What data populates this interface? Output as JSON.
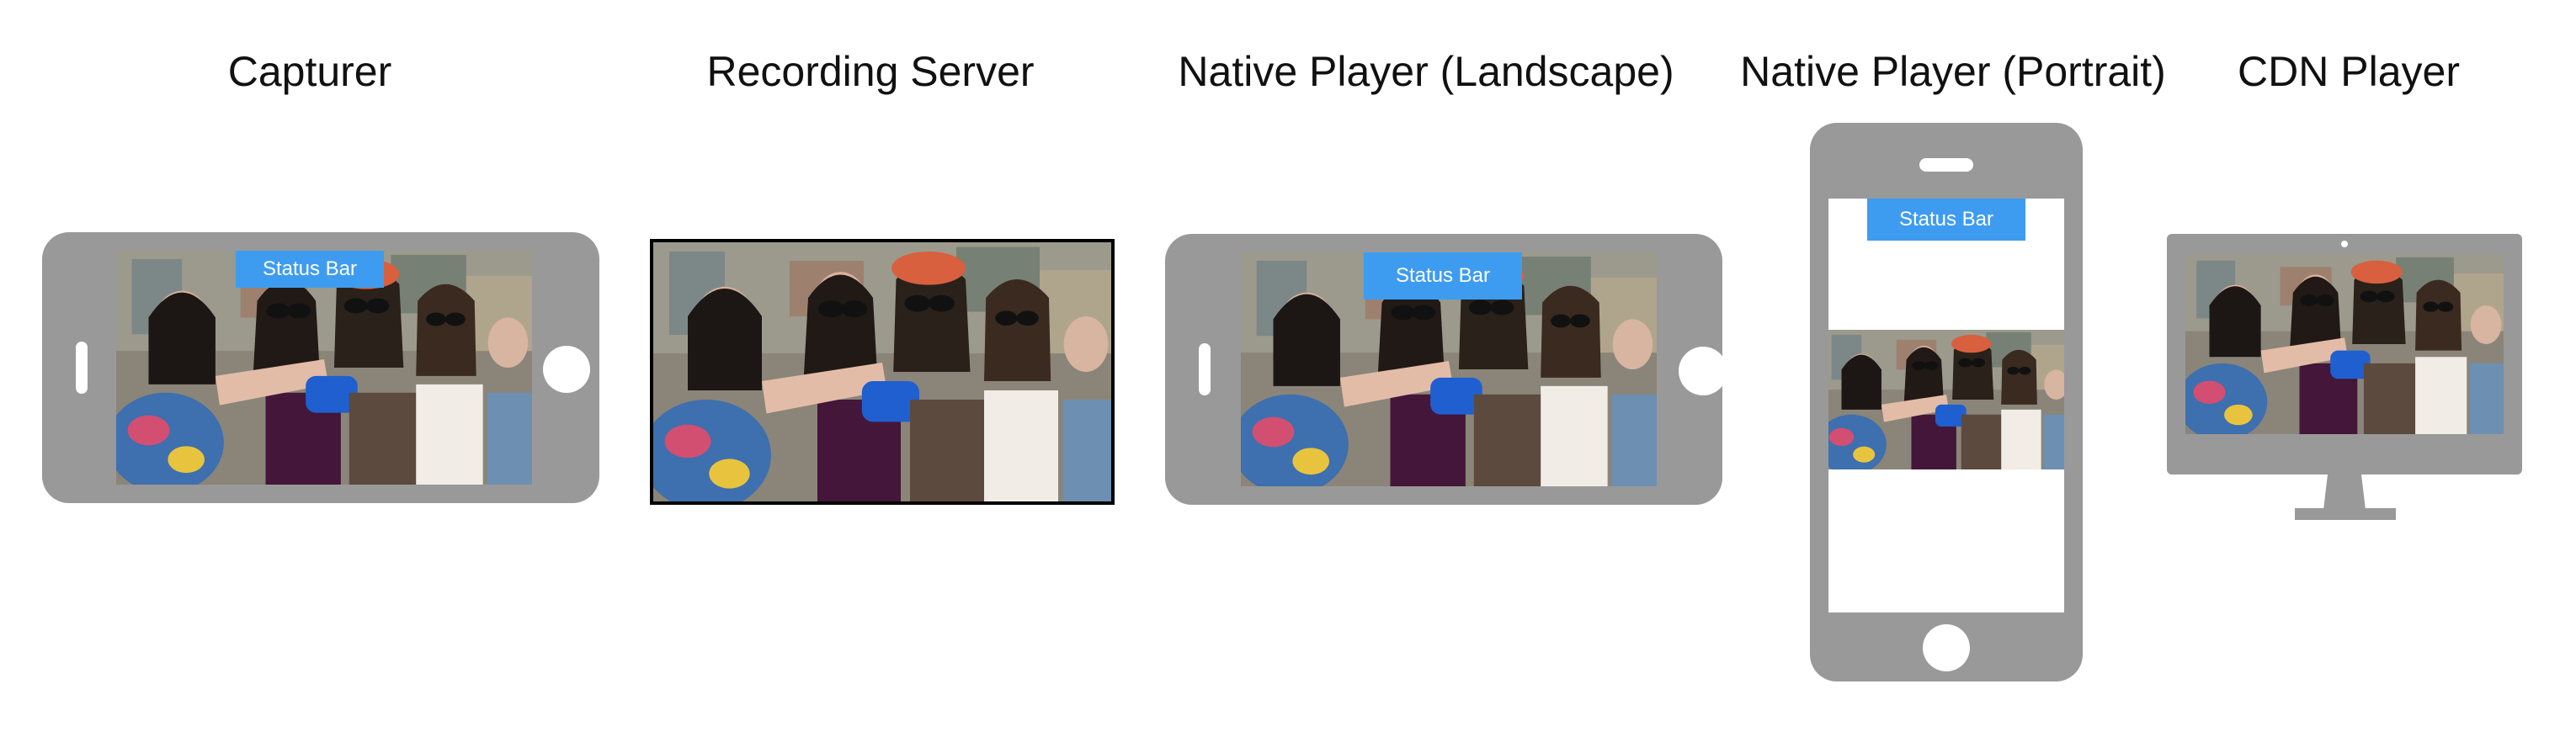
{
  "colors": {
    "device_grey": "#999999",
    "status_blue": "#3e9cf0",
    "frame_black": "#000000"
  },
  "panels": {
    "capturer": {
      "title": "Capturer",
      "status_bar": "Status Bar"
    },
    "recording_server": {
      "title": "Recording Server"
    },
    "native_landscape": {
      "title": "Native Player (Landscape)",
      "status_bar": "Status Bar"
    },
    "native_portrait": {
      "title": "Native Player (Portrait)",
      "status_bar": "Status Bar"
    },
    "cdn_player": {
      "title": "CDN Player"
    }
  }
}
